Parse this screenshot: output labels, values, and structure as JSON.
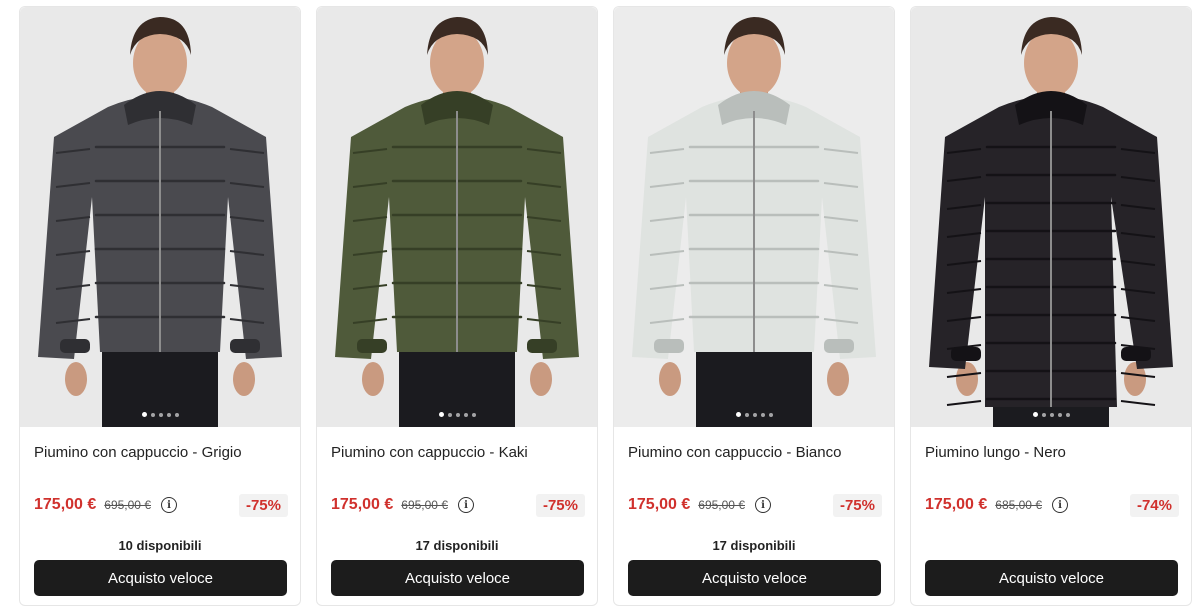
{
  "products": [
    {
      "title": "Piumino con cappuccio - Grigio",
      "price": "175,00 €",
      "old_price": "695,00 €",
      "discount": "-75%",
      "availability": "10 disponibili",
      "button_label": "Acquisto veloce",
      "jacket_color": "#4a4a4f",
      "jacket_shade": "#2f2f33",
      "bg_color": "#e9e9e9"
    },
    {
      "title": "Piumino con cappuccio - Kaki",
      "price": "175,00 €",
      "old_price": "695,00 €",
      "discount": "-75%",
      "availability": "17 disponibili",
      "button_label": "Acquisto veloce",
      "jacket_color": "#4f5a3a",
      "jacket_shade": "#363f26",
      "bg_color": "#e9e9e9"
    },
    {
      "title": "Piumino con cappuccio - Bianco",
      "price": "175,00 €",
      "old_price": "695,00 €",
      "discount": "-75%",
      "availability": "17 disponibili",
      "button_label": "Acquisto veloce",
      "jacket_color": "#dfe3e0",
      "jacket_shade": "#b9bebb",
      "bg_color": "#ececec"
    },
    {
      "title": "Piumino lungo - Nero",
      "price": "175,00 €",
      "old_price": "685,00 €",
      "discount": "-74%",
      "availability": "",
      "button_label": "Acquisto veloce",
      "jacket_color": "#262328",
      "jacket_shade": "#141216",
      "bg_color": "#e9e9e9"
    }
  ]
}
